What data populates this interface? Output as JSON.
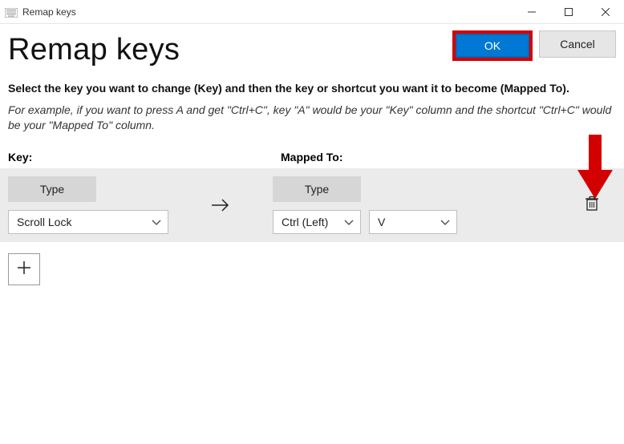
{
  "window": {
    "title": "Remap keys"
  },
  "page": {
    "heading": "Remap keys",
    "instructions": "Select the key you want to change (Key) and then the key or shortcut you want it to become (Mapped To).",
    "example": "For example, if you want to press A and get \"Ctrl+C\", key \"A\" would be your \"Key\" column and the shortcut \"Ctrl+C\" would be your \"Mapped To\" column."
  },
  "buttons": {
    "ok": "OK",
    "cancel": "Cancel"
  },
  "columns": {
    "key": "Key:",
    "mapped": "Mapped To:"
  },
  "row": {
    "type_label": "Type",
    "key_select": "Scroll Lock",
    "mapped_mod": "Ctrl (Left)",
    "mapped_key": "V"
  },
  "colors": {
    "accent": "#0078d4",
    "highlight_border": "#d30000"
  }
}
